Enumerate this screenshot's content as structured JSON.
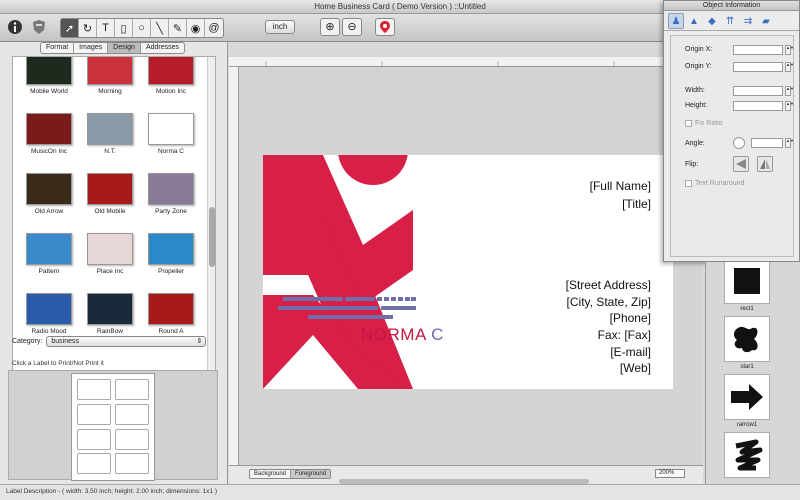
{
  "window": {
    "title": "Home Business Card ( Demo Version ) ::Untitled"
  },
  "toolbar": {
    "info_icon": "info-icon",
    "tools": [
      "arrow-tool",
      "rotate-tool",
      "text-tool",
      "rect-tool",
      "ellipse-tool",
      "line-tool",
      "pen-tool",
      "fill-tool",
      "at-tool"
    ],
    "unit_label": "inch",
    "zoom_in": "zoom-in-icon",
    "zoom_out": "zoom-out-icon",
    "pin": "map-pin-icon"
  },
  "left_panel": {
    "tabs": [
      "Format",
      "Images",
      "Design",
      "Addresses"
    ],
    "active_tab": "Design",
    "templates": [
      {
        "name": "Mobile World",
        "color": "#1e2a1e"
      },
      {
        "name": "Morning",
        "color": "#c9323a"
      },
      {
        "name": "Motion Inc",
        "color": "#b51d2a"
      },
      {
        "name": "MusicOn Inc",
        "color": "#7a1a1a"
      },
      {
        "name": "N.T.",
        "color": "#8a9aa6"
      },
      {
        "name": "Norma C",
        "color": "#ffffff"
      },
      {
        "name": "Old Arrow",
        "color": "#3a2a1a"
      },
      {
        "name": "Old Mobile",
        "color": "#a81a1a"
      },
      {
        "name": "Party Zone",
        "color": "#8a7a9a"
      },
      {
        "name": "Pattern",
        "color": "#3a8acb"
      },
      {
        "name": "Place Inc",
        "color": "#e6d6d6"
      },
      {
        "name": "Propeller",
        "color": "#2a8ac8"
      },
      {
        "name": "Radio Mood",
        "color": "#2a5aaa"
      },
      {
        "name": "RainBow",
        "color": "#1a2a3a"
      },
      {
        "name": "Round A",
        "color": "#a81a1a"
      }
    ],
    "category_label": "Category:",
    "category_value": "business",
    "hint": "Click a Label to Print/Not Print it"
  },
  "card": {
    "full_name": "[Full Name]",
    "title": "[Title]",
    "street": "[Street Address]",
    "city": "[City, State, Zip]",
    "phone": "[Phone]",
    "fax_label": "Fax:",
    "fax": "[Fax]",
    "email": "[E-mail]",
    "web": "[Web]",
    "brand_main": "NORMA",
    "brand_c": "C",
    "accent": "#d81f48",
    "bars": "#6c6fa8"
  },
  "canvas_bottom": {
    "layers": [
      "Background",
      "Foreground"
    ],
    "zoom": "200%"
  },
  "inspector": {
    "title": "Object Information",
    "origin_x": "Origin X:",
    "origin_y": "Origin Y:",
    "width": "Width:",
    "height": "Height:",
    "fix_ratio": "Fix Ratio",
    "angle": "Angle:",
    "flip": "Flip:",
    "text_runaround": "Text Runaround"
  },
  "shapes": [
    {
      "name": "rect1"
    },
    {
      "name": "star1"
    },
    {
      "name": "rarrow1"
    },
    {
      "name": ""
    }
  ],
  "status": "Label Description - ( width: 3.50 inch; height: 2.00 inch; dimensions: 1x1 )"
}
